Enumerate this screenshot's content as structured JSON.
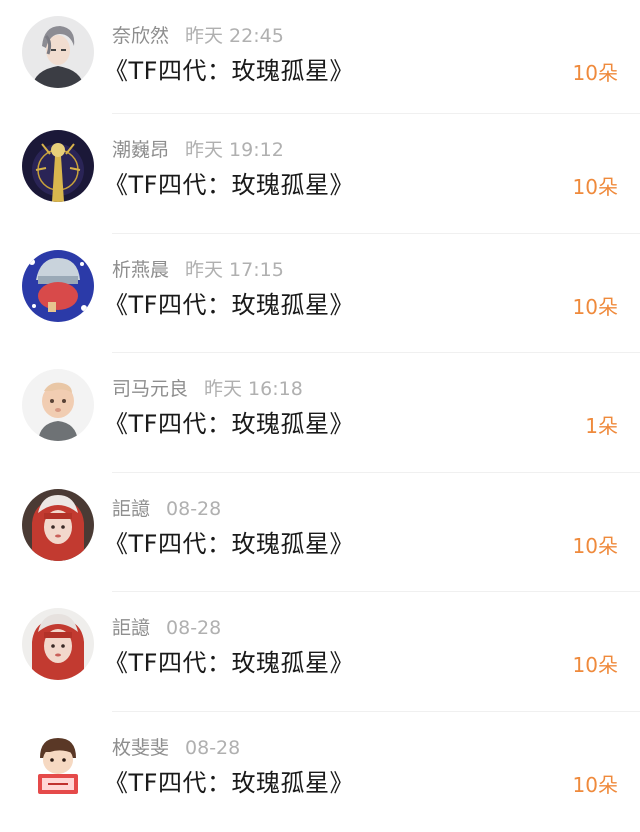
{
  "gifts": [
    {
      "name": "奈欣然",
      "time": "昨天 22:45",
      "title": "《TF四代：玫瑰孤星》",
      "amount": "10朵",
      "avatar": "anime-boy-avatar"
    },
    {
      "name": "潮巍昂",
      "time": "昨天 19:12",
      "title": "《TF四代：玫瑰孤星》",
      "amount": "10朵",
      "avatar": "golden-figure-avatar"
    },
    {
      "name": "析燕晨",
      "time": "昨天 17:15",
      "title": "《TF四代：玫瑰孤星》",
      "amount": "10朵",
      "avatar": "ninja-cartoon-avatar"
    },
    {
      "name": "司马元良",
      "time": "昨天 16:18",
      "title": "《TF四代：玫瑰孤星》",
      "amount": "1朵",
      "avatar": "baby-photo-avatar"
    },
    {
      "name": "詎譩",
      "time": "08-28",
      "title": "《TF四代：玫瑰孤星》",
      "amount": "10朵",
      "avatar": "red-hair-girl-avatar"
    },
    {
      "name": "詎譩",
      "time": "08-28",
      "title": "《TF四代：玫瑰孤星》",
      "amount": "10朵",
      "avatar": "red-hair-girl-avatar"
    },
    {
      "name": "枚斐斐",
      "time": "08-28",
      "title": "《TF四代：玫瑰孤星》",
      "amount": "10朵",
      "avatar": "cartoon-boy-sign-avatar"
    }
  ],
  "colors": {
    "amount": "#ef8a3c",
    "name": "#8e8e8e",
    "time": "#b0b0b0",
    "title": "#1a1a1a"
  }
}
